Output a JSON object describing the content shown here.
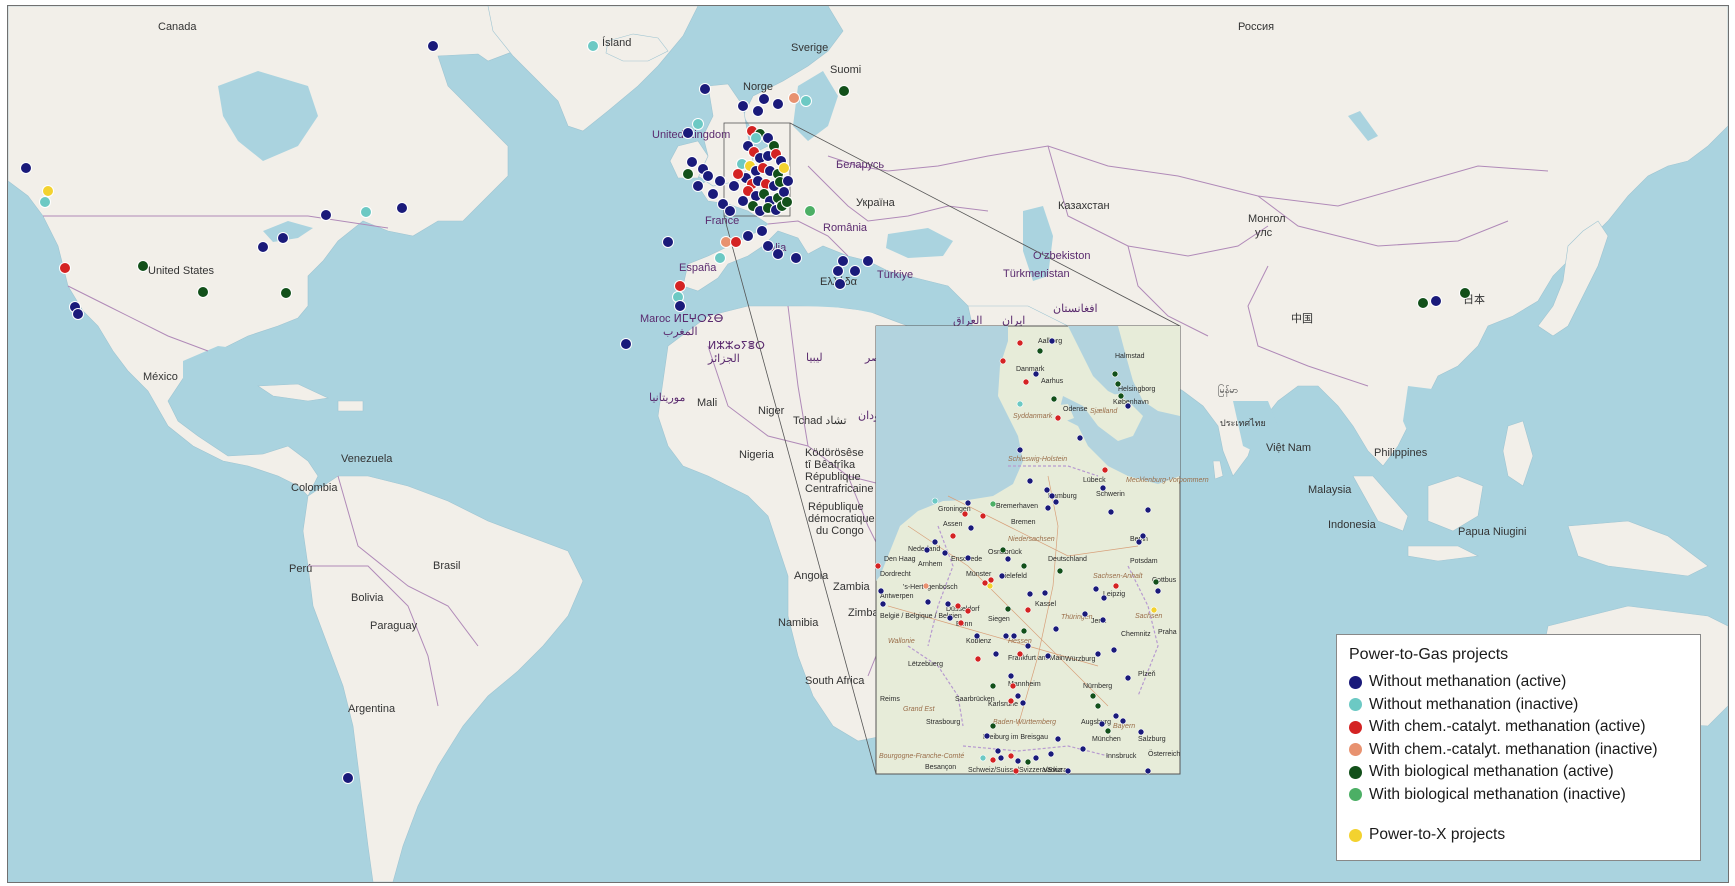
{
  "legend": {
    "title": "Power-to-Gas projects",
    "items": [
      {
        "key": "wm_active",
        "label": "Without methanation (active)",
        "color": "#1a1a7a"
      },
      {
        "key": "wm_inactive",
        "label": "Without methanation (inactive)",
        "color": "#6cc9c4"
      },
      {
        "key": "cc_active",
        "label": "With chem.-catalyt. methanation (active)",
        "color": "#d42323"
      },
      {
        "key": "cc_inactive",
        "label": "With chem.-catalyt. methanation (inactive)",
        "color": "#e89270"
      },
      {
        "key": "bio_active",
        "label": "With biological methanation (active)",
        "color": "#12501a"
      },
      {
        "key": "bio_inactive",
        "label": "With biological methanation (inactive)",
        "color": "#4caf65"
      },
      {
        "key": "ptx",
        "label": "Power-to-X projects",
        "color": "#f3d22f"
      }
    ]
  },
  "colors": {
    "ocean": "#aad3df",
    "land": "#f2efe9",
    "border": "#b08ab8",
    "inset_land": "#e7ecd9",
    "inset_sea": "#b2d3de"
  },
  "world_labels": {
    "canada": "Canada",
    "island": "Ísland",
    "sverige": "Sverige",
    "suomi": "Suomi",
    "norge": "Norge",
    "rossiya": "Россия",
    "uk": "United Kingdom",
    "belarus": "Беларусь",
    "ukraina": "Україна",
    "kazakhstan": "Казахстан",
    "mongol": "Монгол",
    "mongol2": "улс",
    "romania": "România",
    "france": "France",
    "italia": "Italia",
    "espana": "España",
    "uzbekiston": "O‘zbekiston",
    "turkmenistan": "Türkmenistan",
    "ellada": "Ελλάδα",
    "turkiye": "Türkiye",
    "afghanistan": "افغانستان",
    "iraq": "العراق",
    "iran": "ایران",
    "china": "中国",
    "japan": "日本",
    "myanmar": "မြန်မာ",
    "thailand": "ประเทศไทย",
    "vietnam": "Việt Nam",
    "philippines": "Philippines",
    "malaysia": "Malaysia",
    "indonesia": "Indonesia",
    "png": "Papua Niugini",
    "us": "United States",
    "mexico": "México",
    "maroc": "Maroc ⵍⵎⵖⵔⵉⴱ",
    "maghrib": "المغرب",
    "algeria": "ⵍⵣⵣⴰⵢⴻⵔ",
    "algeria2": "الجزائر",
    "libya": "ليبيا",
    "egypt": "مصر",
    "mauritania": "موريتانيا",
    "mali": "Mali",
    "niger": "Niger",
    "tchad": "Tchad تشاد",
    "sudan": "السودان",
    "nigeria": "Nigeria",
    "car1": "Ködörösêse",
    "car2": "tî Bêafrîka",
    "car3": "République",
    "car4": "Centrafricaine",
    "drc1": "République",
    "drc2": "démocratique",
    "drc3": "du Congo",
    "angola": "Angola",
    "zambia": "Zambia",
    "zimbabwe": "Zimba",
    "namibia": "Namibia",
    "south_africa": "South Africa",
    "venezuela": "Venezuela",
    "colombia": "Colombia",
    "peru": "Perú",
    "brasil": "Brasil",
    "bolivia": "Bolivia",
    "paraguay": "Paraguay",
    "argentina": "Argentina"
  },
  "inset_labels": {
    "aalborg": "Aalborg",
    "halmstad": "Halmstad",
    "danmark": "Danmark",
    "aarhus": "Aarhus",
    "helsingborg": "Helsingborg",
    "kobenhavn": "København",
    "sjaelland": "Sjælland",
    "odense": "Odense",
    "syddanmark": "Syddanmark",
    "schleswig": "Schleswig-Holstein",
    "lubeck": "Lübeck",
    "mecklenburg": "Mecklenburg-Vorpommern",
    "schwerin": "Schwerin",
    "hamburg": "Hamburg",
    "groningen": "Groningen",
    "bremerhaven": "Bremerhaven",
    "bremen": "Bremen",
    "assen": "Assen",
    "niedersachsen": "Niedersachsen",
    "berlin": "Berlin",
    "potsdam": "Potsdam",
    "nederland": "Nederland",
    "arnhem": "Arnhem",
    "enschede": "Enschede",
    "osnabruck": "Osnabrück",
    "deutschland": "Deutschland",
    "denhaag": "Den Haag",
    "dordrecht": "Dordrecht",
    "hertogenbosch": "'s-Hertogenbosch",
    "munster": "Münster",
    "bielefeld": "Bielefeld",
    "sachsen_anhalt": "Sachsen-Anhalt",
    "cottbus": "Cottbus",
    "antwerpen": "Antwerpen",
    "dusseldorf": "Düsseldorf",
    "kassel": "Kassel",
    "leipzig": "Leipzig",
    "belgie": "België / Belgique / Belgien",
    "bonn": "Bonn",
    "siegen": "Siegen",
    "thuringen": "Thüringen",
    "jena": "Jena",
    "sachsen": "Sachsen",
    "chemnitz": "Chemnitz",
    "koblenz": "Koblenz",
    "hessen": "Hessen",
    "wallonie": "Wallonie",
    "frankfurt": "Frankfurt am Main",
    "wurzburg": "Würzburg",
    "letzebuerg": "Lëtzebuerg",
    "plzen": "Plzeň",
    "mannheim": "Mannheim",
    "nurnberg": "Nürnberg",
    "saarbrucken": "Saarbrücken",
    "karlsruhe": "Karlsruhe",
    "reims": "Reims",
    "grandest": "Grand Est",
    "strasbourg": "Strasbourg",
    "bw": "Baden-Württemberg",
    "augsburg": "Augsburg",
    "bayern": "Bayern",
    "munchen": "München",
    "salzburg": "Salzburg",
    "freiburg": "Freiburg im Breisgau",
    "innsbruck": "Innsbruck",
    "osterreich": "Österreich",
    "besancon": "Besançon",
    "bourgogne": "Bourgogne-Franche-Comté",
    "schweiz": "Schweiz/Suisse/Svizzera/Svizra",
    "vaduz": "Vaduz",
    "praha": "Praha"
  }
}
